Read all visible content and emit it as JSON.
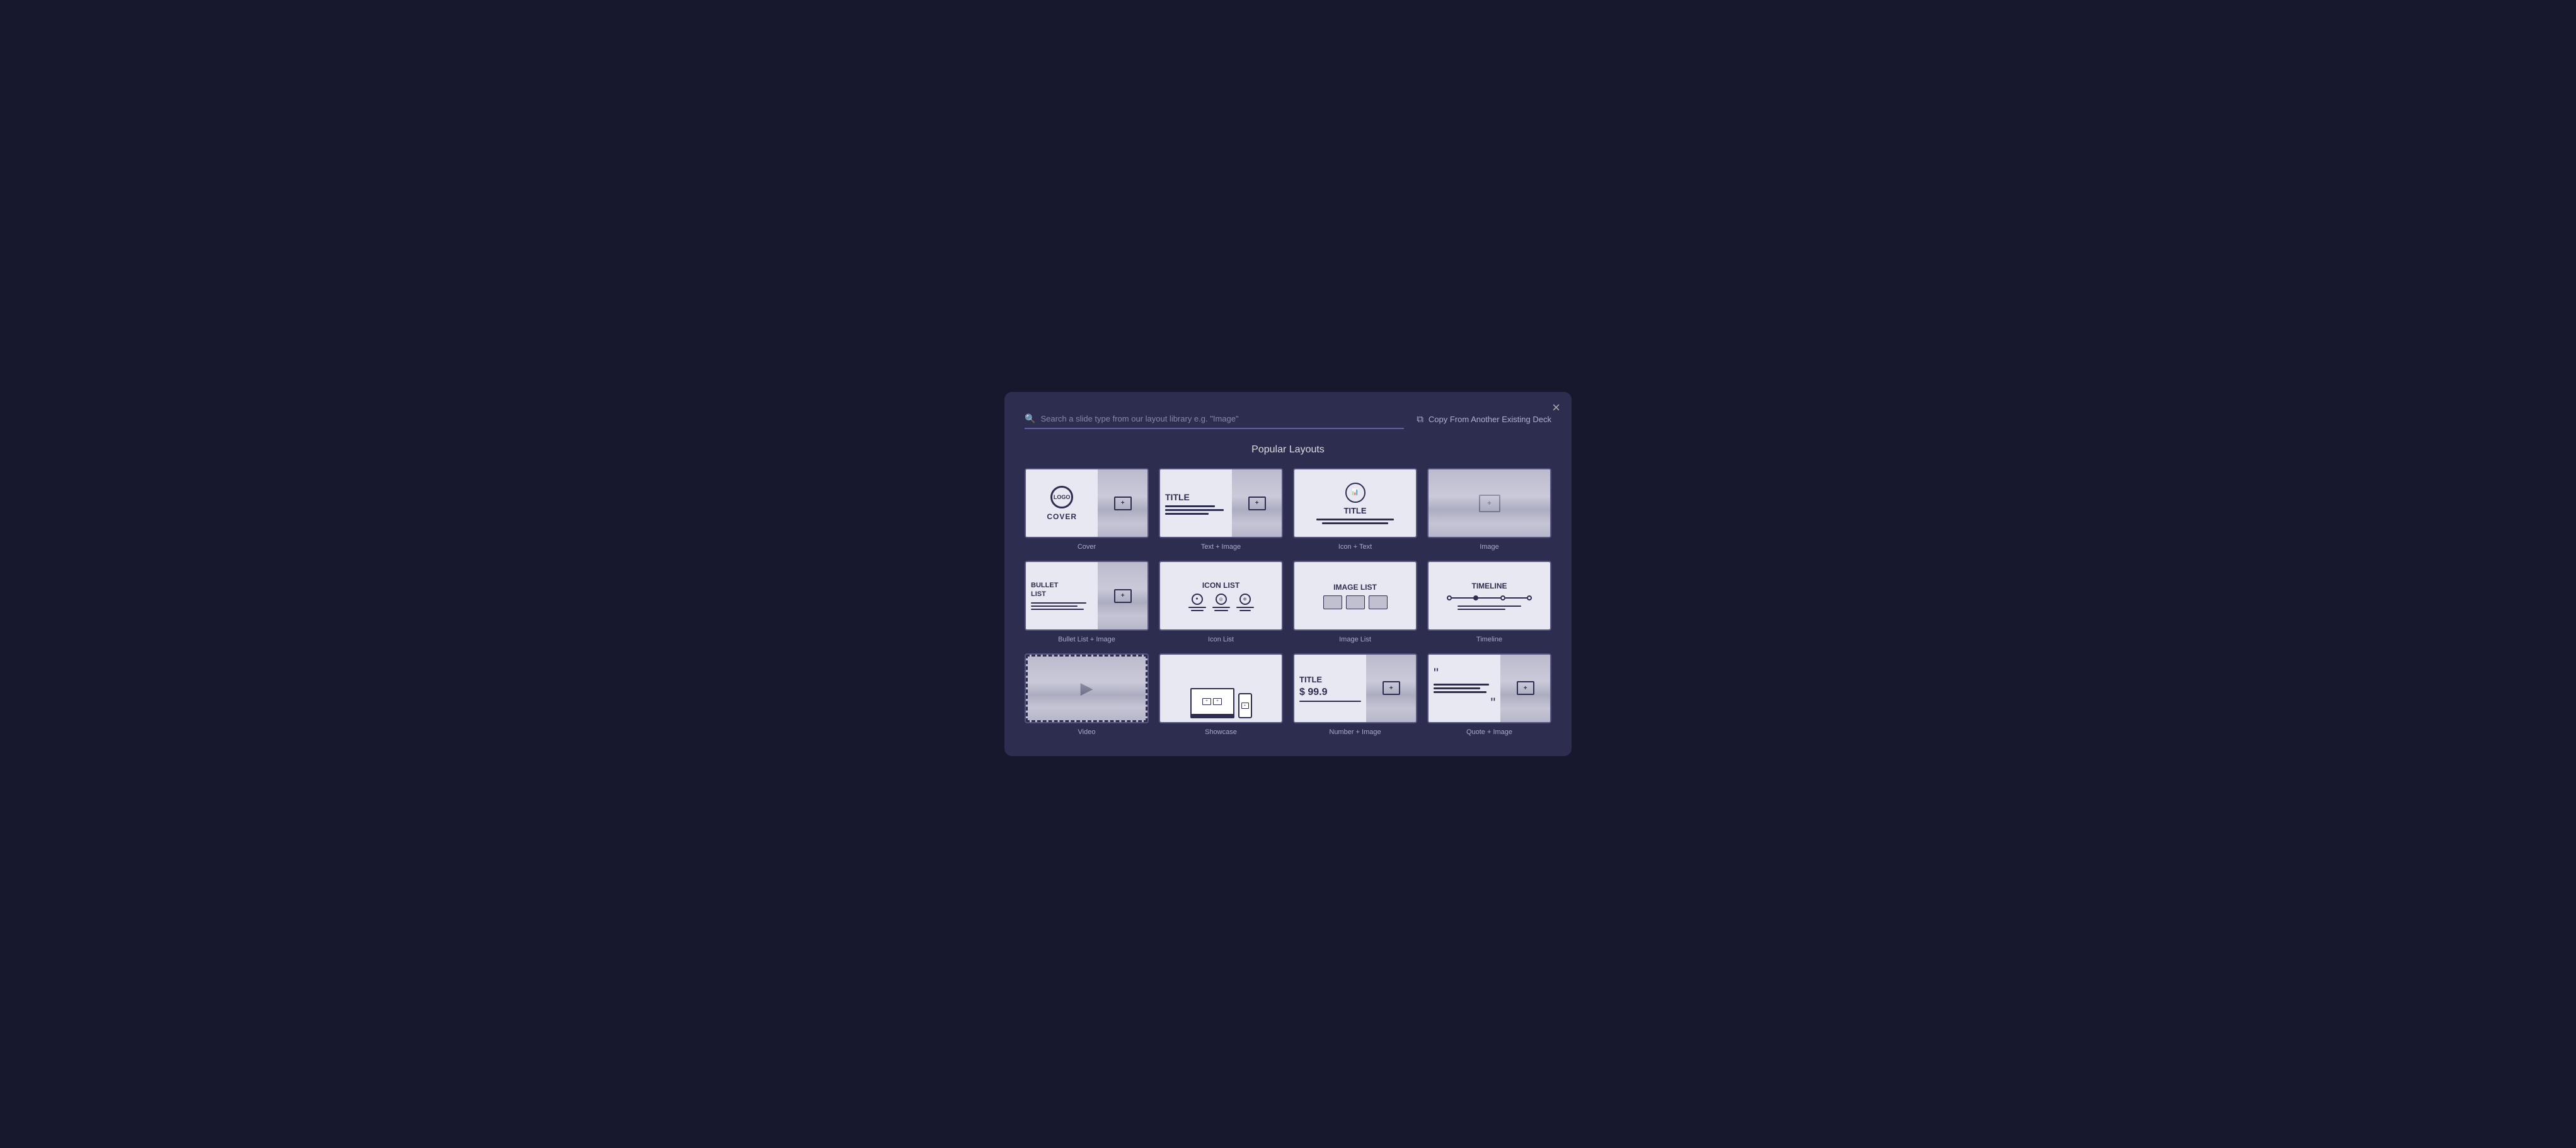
{
  "modal": {
    "title": "Popular Layouts",
    "close_label": "×",
    "search_placeholder": "Search a slide type from our layout library e.g. \"Image\"",
    "copy_btn_label": "Copy From Another Existing Deck"
  },
  "layouts": [
    {
      "id": "cover",
      "label": "Cover",
      "type": "cover"
    },
    {
      "id": "text-image",
      "label": "Text + Image",
      "type": "textimg"
    },
    {
      "id": "icon-text",
      "label": "Icon + Text",
      "type": "icontext"
    },
    {
      "id": "image",
      "label": "Image",
      "type": "image-only"
    },
    {
      "id": "bullet-list",
      "label": "Bullet List + Image",
      "type": "bullet"
    },
    {
      "id": "icon-list",
      "label": "Icon List",
      "type": "iconlist"
    },
    {
      "id": "image-list",
      "label": "Image List",
      "type": "imagelist"
    },
    {
      "id": "timeline",
      "label": "Timeline",
      "type": "timeline"
    },
    {
      "id": "video",
      "label": "Video",
      "type": "video"
    },
    {
      "id": "showcase",
      "label": "Showcase",
      "type": "showcase"
    },
    {
      "id": "number-image",
      "label": "Number + Image",
      "type": "number"
    },
    {
      "id": "quote-image",
      "label": "Quote + Image",
      "type": "quote"
    }
  ]
}
